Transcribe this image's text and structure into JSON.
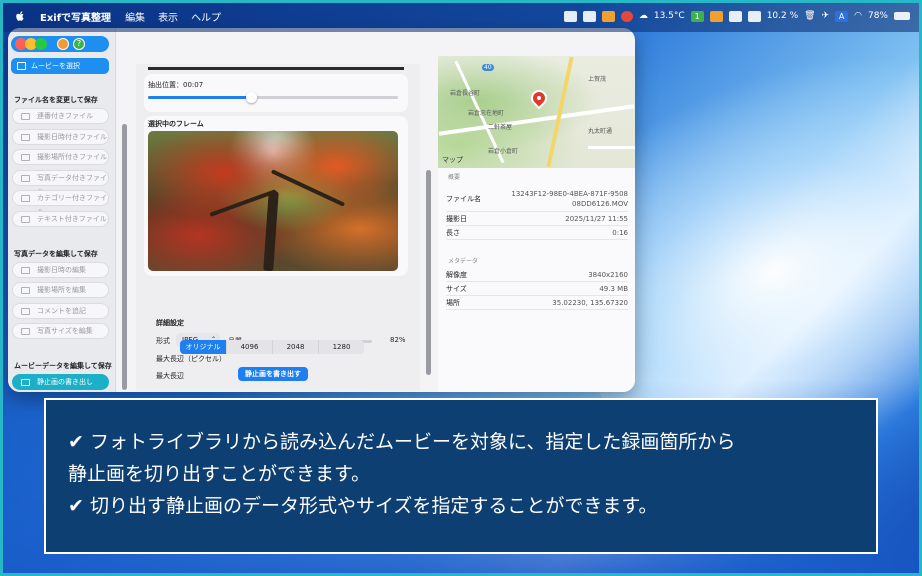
{
  "menubar": {
    "app_name": "Exifで写真整理",
    "menus": [
      "編集",
      "表示",
      "ヘルプ"
    ],
    "temperature": "13.5°C",
    "percent_left": "10.2 %",
    "battery": "78%",
    "badge_num": "1",
    "input_letter": "A"
  },
  "sidebar": {
    "select_movie": "ムービーを選択",
    "section1": "ファイル名を変更して保存",
    "section1_items": [
      "連番付きファイル",
      "撮影日時付きファイル",
      "撮影場所付きファイル",
      "写真データ付きファイル",
      "カテゴリー付きファイル",
      "テキスト付きファイル"
    ],
    "section2": "写真データを編集して保存",
    "section2_items": [
      "撮影日時の編集",
      "撮影場所を編集",
      "コメントを追記",
      "写真サイズを編集"
    ],
    "section3": "ムービーデータを編集して保存",
    "section3_items": [
      "静止画の書き出し"
    ]
  },
  "center": {
    "position_label": "抽出位置：00:07",
    "position_progress": 0.41,
    "frame_heading": "選択中のフレーム",
    "details_heading": "詳細設定",
    "format_label": "形式",
    "format_value": "JPEG",
    "quality_label": "品質",
    "quality_value": "82%",
    "quality_progress": 0.6,
    "maxedge_heading": "最大長辺（ピクセル）",
    "maxedge_label": "最大長辺",
    "maxedge_options": [
      "オリジナル",
      "4096",
      "2048",
      "1280"
    ],
    "maxedge_selected": 0,
    "export_button": "静止画を書き出す"
  },
  "map": {
    "label_top": "岩倉長谷町",
    "label_top2": "上賀茂",
    "label_mid": "岩倉忠在地町",
    "label_school": "二軒茶屋",
    "label_bottom": "岩倉小倉町",
    "label_maps": "マップ",
    "label_right": "丸太町通",
    "label_road": "40"
  },
  "summary": {
    "heading": "概要",
    "rows": [
      {
        "k": "ファイル名",
        "v": "13243F12-98E0-4BEA-871F-950808DD6126.MOV"
      },
      {
        "k": "撮影日",
        "v": "2025/11/27 11:55"
      },
      {
        "k": "長さ",
        "v": "0:16"
      }
    ]
  },
  "metadata": {
    "heading": "メタデータ",
    "rows": [
      {
        "k": "解像度",
        "v": "3840x2160"
      },
      {
        "k": "サイズ",
        "v": "49.3 MB"
      },
      {
        "k": "場所",
        "v": "35.02230, 135.67320"
      }
    ]
  },
  "caption": {
    "line1": "✔ フォトライブラリから読み込んだムービーを対象に、指定した録画箇所から",
    "line2": "静止画を切り出すことができます。",
    "line3": "✔ 切り出す静止画のデータ形式やサイズを指定することができます。"
  }
}
